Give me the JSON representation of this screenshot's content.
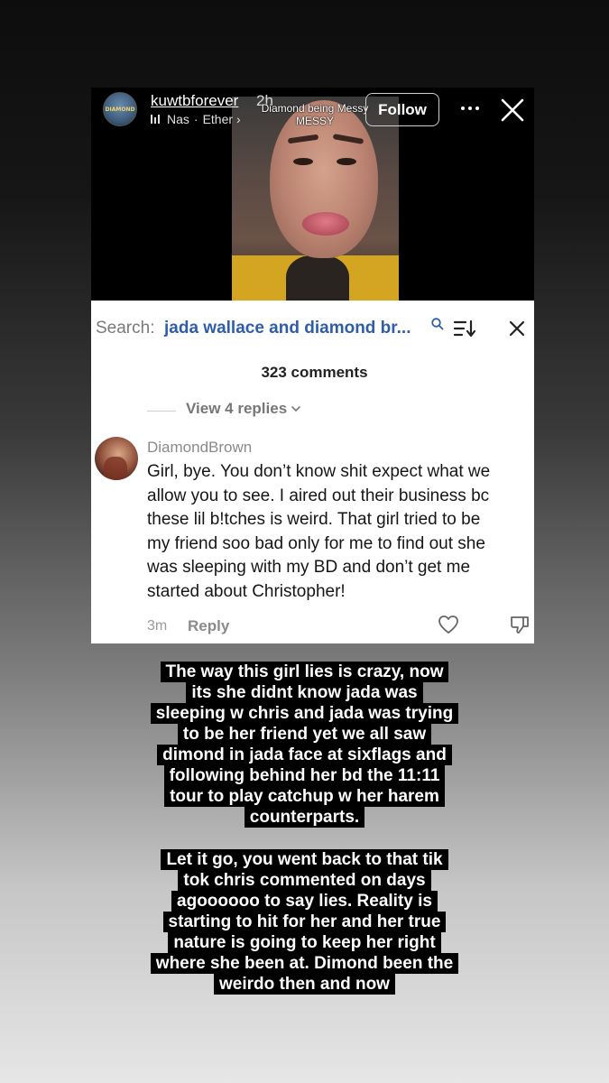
{
  "post": {
    "username": "kuwtbforever",
    "time": "2h",
    "music_artist": "Nas",
    "music_track": "Ether",
    "music_chevron": "›",
    "video_overlay_line1": "Diamond being Messy",
    "video_overlay_line2": "MESSY",
    "follow_label": "Follow",
    "avatar_text": "DIAMOND"
  },
  "comments": {
    "search_label": "Search:",
    "search_query": "jada wallace and diamond br...",
    "count": "323 comments",
    "view_replies": "View 4 replies",
    "comment": {
      "username": "DiamondBrown",
      "lines": [
        "Girl, bye. You don’t know shit expect what we",
        "allow you to see. I aired out their business bc",
        "these lil b!tches is weird. That girl tried to be",
        "my friend soo bad only for me to find out she",
        "was sleeping with my BD and don’t get me",
        "started about Christopher!"
      ],
      "time": "3m",
      "reply_label": "Reply"
    }
  },
  "caption": {
    "block1": [
      "The way this girl lies is crazy, now",
      "its she didnt know jada was",
      "sleeping w chris and jada was trying",
      "to be her friend yet we all saw",
      "dimond in jada face at sixflags and",
      "following behind her bd the 11:11",
      "tour to play catchup w her harem",
      "counterparts."
    ],
    "block2": [
      "Let it go, you went back to that tik",
      "tok chris commented on days",
      "agoooooo to say lies. Reality is",
      "starting to hit for her and her true",
      "nature is going to keep her right",
      "where she been at. Dimond been the",
      "weirdo then and now"
    ]
  },
  "icons": {
    "more": "more-horizontal-icon",
    "close": "close-icon",
    "search": "search-icon",
    "sort": "sort-icon",
    "heart": "heart-icon",
    "dislike": "dislike-icon",
    "music": "music-bars-icon",
    "chevron": "chevron-down-icon"
  },
  "colors": {
    "search_query": "#2f5da8",
    "caption_bg": "#000000",
    "caption_text": "#ffffff"
  }
}
